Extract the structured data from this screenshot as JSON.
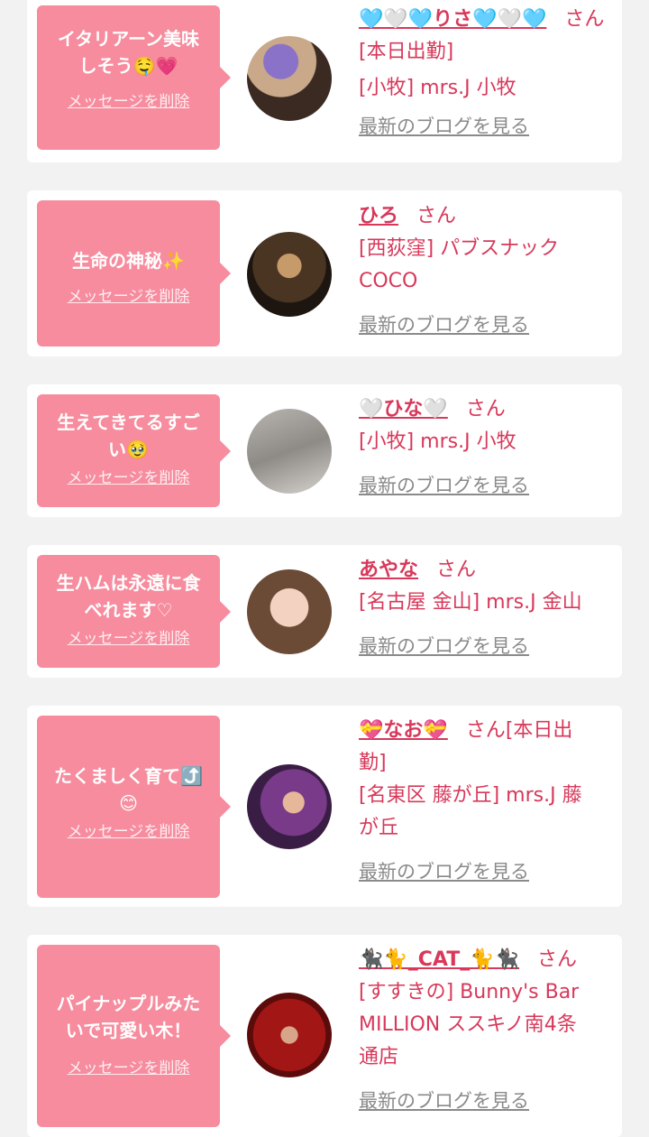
{
  "delete_label": "メッセージを削除",
  "blog_label": "最新のブログを見る",
  "honorific": "さん",
  "accent_color": "#d8385a",
  "bubble_color": "#f68c9e",
  "cards": [
    {
      "message": "イタリアーン美味\nしそう🤤💗",
      "name": "🩵🤍🩵りさ🩵🤍🩵",
      "status": "[本日出勤]",
      "shop": "[小牧] mrs.J 小牧"
    },
    {
      "message": "生命の神秘✨",
      "name": "ひろ",
      "status": "",
      "shop": "[西荻窪] パブスナック\nCOCO"
    },
    {
      "message": "生えてきてるすご\nい🥹",
      "name": "🤍ひな🤍",
      "status": "",
      "shop": "[小牧] mrs.J 小牧"
    },
    {
      "message": "生ハムは永遠に食\nべれます♡",
      "name": "あやな",
      "status": "",
      "shop": "[名古屋 金山] mrs.J 金山"
    },
    {
      "message": "たくましく育て⤴️\n😊",
      "name": "💝なお💝",
      "status": "[本日出\n勤]",
      "shop": "[名東区 藤が丘] mrs.J 藤\nが丘"
    },
    {
      "message": "パイナップルみた\nいで可愛い木！",
      "name": "🐈‍⬛🐈_CAT_🐈🐈‍⬛",
      "status": "",
      "shop": "[すすきの] Bunny's Bar\nMILLION ススキノ南4条\n通店"
    }
  ]
}
